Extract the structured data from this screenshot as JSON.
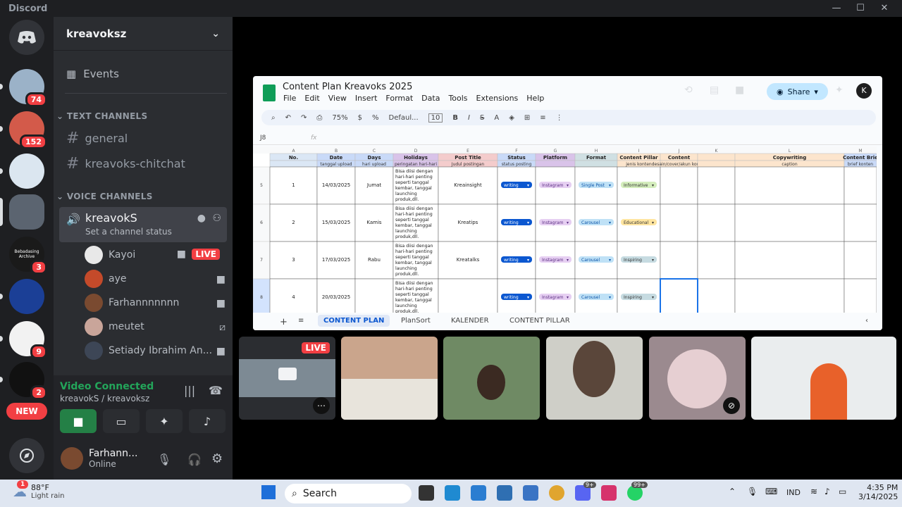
{
  "app_title": "Discord",
  "window_controls": {
    "minimize": "—",
    "maximize": "☐",
    "close": "✕"
  },
  "servers": [
    {
      "badge": "74",
      "color": "#9bb2c8"
    },
    {
      "badge": "152",
      "color": "#d35a4a"
    },
    {
      "badge": "",
      "color": "#dbe6f0"
    },
    {
      "badge": "",
      "color": "#5b6470"
    },
    {
      "badge": "3",
      "color": "#1a1a1a",
      "text": "Bebadasing Archive"
    },
    {
      "badge": "",
      "color": "#1b3f96"
    },
    {
      "badge": "9",
      "color": "#f2f2f2"
    },
    {
      "badge": "2",
      "color": "#111111"
    }
  ],
  "new_badge": "NEW",
  "guild": {
    "name": "kreavoksz"
  },
  "events_label": "Events",
  "text_channels": {
    "category": "TEXT CHANNELS",
    "items": [
      "general",
      "kreavoks-chitchat"
    ]
  },
  "voice_channels": {
    "category": "VOICE CHANNELS",
    "channel": "kreavokS",
    "status": "Set a channel status",
    "users": [
      {
        "name": "Kayoi",
        "live": "LIVE"
      },
      {
        "name": "aye"
      },
      {
        "name": "Farhannnnnnn"
      },
      {
        "name": "meutet"
      },
      {
        "name": "Setiady Ibrahim An..."
      }
    ]
  },
  "panel": {
    "status": "Video Connected",
    "location": "kreavokS / kreavoksz"
  },
  "me": {
    "name": "Farhann...",
    "status": "Online"
  },
  "sheet": {
    "title": "Content Plan Kreavoks 2025",
    "menu": [
      "File",
      "Edit",
      "View",
      "Insert",
      "Format",
      "Data",
      "Tools",
      "Extensions",
      "Help"
    ],
    "share": "Share",
    "avatar": "K",
    "zoom": "75%",
    "font": "Defaul...",
    "font_size": "10",
    "cell_ref": "J8",
    "col_letters": [
      "A",
      "B",
      "C",
      "D",
      "E",
      "F",
      "G",
      "H",
      "I",
      "J",
      "K",
      "L",
      "M"
    ],
    "headers": [
      "No.",
      "Date",
      "Days",
      "Holidays",
      "Post Title",
      "Status",
      "Platform",
      "Format",
      "Content Pillar",
      "Content",
      "",
      "Copywriting",
      "Content Brie"
    ],
    "subheaders": [
      "",
      "tanggal upload",
      "hari upload",
      "peringatan hari-hari",
      "Judul postingan",
      "status posting",
      "",
      "",
      "jenis konten",
      "desain/cover/akun konten",
      "",
      "caption",
      "brief konten"
    ],
    "holiday_text": "Bisa diisi dengan hari-hari penting seperti tanggal kembar, tanggal launching produk,dll.",
    "rows": [
      {
        "row": "5",
        "no": "1",
        "date": "14/03/2025",
        "day": "Jumat",
        "title": "Kreainsight",
        "status": "writing",
        "platform": "Instagram",
        "format": "Single Post",
        "pillar": "Informative",
        "pillar_color": "#d4edbc"
      },
      {
        "row": "6",
        "no": "2",
        "date": "15/03/2025",
        "day": "Kamis",
        "title": "Kreatips",
        "status": "writing",
        "platform": "Instagram",
        "format": "Carousel",
        "pillar": "Educational",
        "pillar_color": "#ffe5a0"
      },
      {
        "row": "7",
        "no": "3",
        "date": "17/03/2025",
        "day": "Rabu",
        "title": "Kreatalks",
        "status": "writing",
        "platform": "Instagram",
        "format": "Carousel",
        "pillar": "Inspiring",
        "pillar_color": "#c6dbe1"
      },
      {
        "row": "8",
        "no": "4",
        "date": "20/03/2025",
        "day": "",
        "title": "",
        "status": "writing",
        "platform": "Instagram",
        "format": "Carousel",
        "pillar": "Inspiring",
        "pillar_color": "#c6dbe1"
      }
    ],
    "tabs": [
      "CONTENT PLAN",
      "PlanSort",
      "KALENDER",
      "CONTENT PILLAR"
    ]
  },
  "stream_tiles": [
    {
      "label": "LIVE"
    },
    {
      "label": ""
    },
    {
      "label": ""
    },
    {
      "label": ""
    },
    {
      "label": ""
    },
    {
      "label": ""
    }
  ],
  "taskbar": {
    "weather_temp": "88°F",
    "weather_desc": "Light rain",
    "weather_badge": "1",
    "search": "Search",
    "discord_badge": "9+",
    "whatsapp_badge": "99+",
    "lang": "IND",
    "time": "4:35 PM",
    "date": "3/14/2025"
  }
}
